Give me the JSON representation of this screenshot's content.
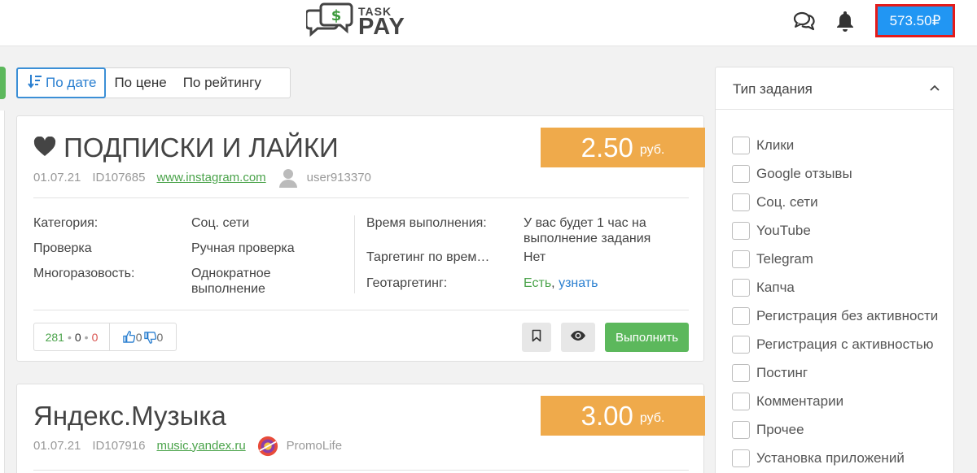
{
  "header": {
    "logo": {
      "line1": "TASK",
      "line2": "PAY",
      "icon": "money-chat-icon"
    },
    "chat_icon": "chat-bubbles-icon",
    "bell_icon": "bell-icon",
    "balance": "573.50₽",
    "colors": {
      "balance_bg": "#2196f3",
      "balance_border": "#e41b1b"
    }
  },
  "sort": {
    "tabs": [
      {
        "label": "По дате",
        "active": true,
        "icon": "sort-desc-icon"
      },
      {
        "label": "По цене",
        "active": false
      },
      {
        "label": "По рейтингу",
        "active": false
      }
    ]
  },
  "tasks": [
    {
      "title_icon": "heart-icon",
      "title": "ПОДПИСКИ И ЛАЙКИ",
      "price": "2.50",
      "currency": "руб.",
      "date": "01.07.21",
      "id": "ID107685",
      "link": "www.instagram.com",
      "user_avatar": "default-avatar-icon",
      "user": "user913370",
      "details": {
        "category_label": "Категория:",
        "category_value": "Соц. сети",
        "check_label": "Проверка",
        "check_value": "Ручная проверка",
        "multi_label": "Многоразовость:",
        "multi_value": "Однократное выполнение",
        "time_label": "Время выполнения:",
        "time_value": "У вас будет 1 час на выполнение задания",
        "time_target_label": "Таргетинг по врем…",
        "time_target_value": "Нет",
        "geo_label": "Геотаргетинг:",
        "geo_value": "Есть",
        "geo_sep": ",",
        "geo_link": "узнать"
      },
      "stats": {
        "done": "281",
        "pending": "0",
        "rejected": "0",
        "likes": "0",
        "dislikes": "0"
      },
      "action": "Выполнить"
    },
    {
      "title": "Яндекс.Музыка",
      "price": "3.00",
      "currency": "руб.",
      "date": "01.07.21",
      "id": "ID107916",
      "link": "music.yandex.ru",
      "user_avatar": "promolife-avatar-icon",
      "user": "PromoLife"
    }
  ],
  "filter": {
    "title": "Тип задания",
    "items": [
      "Клики",
      "Google отзывы",
      "Соц. сети",
      "YouTube",
      "Telegram",
      "Капча",
      "Регистрация без активности",
      "Регистрация с активностью",
      "Постинг",
      "Комментарии",
      "Прочее",
      "Установка приложений"
    ]
  }
}
